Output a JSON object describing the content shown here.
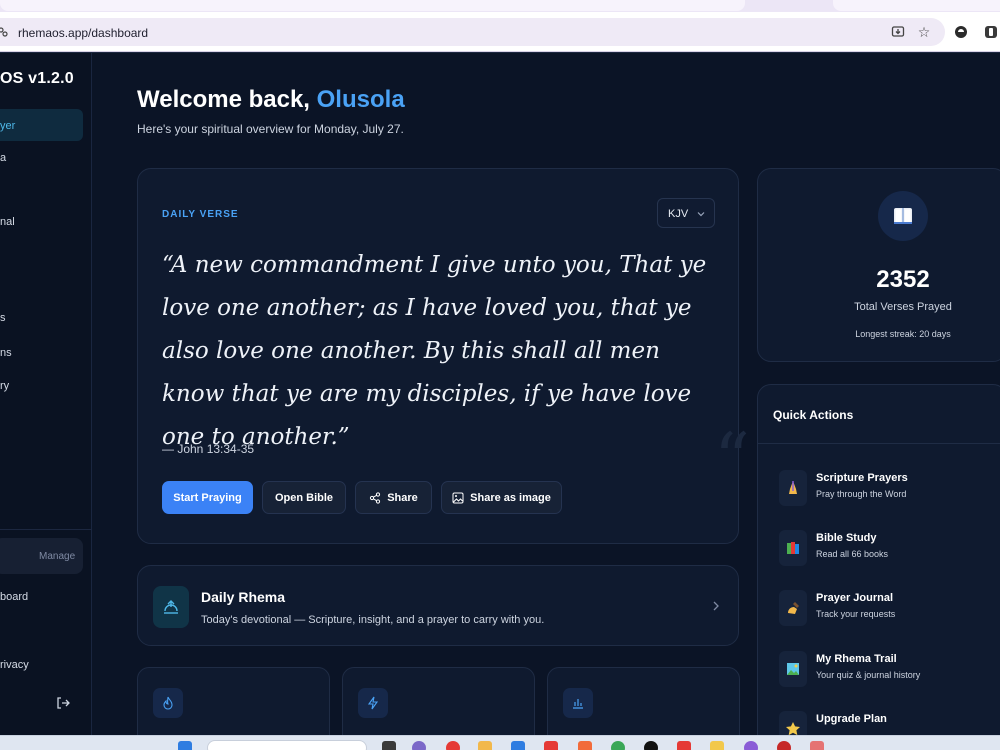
{
  "browser": {
    "url": "rhemaos.app/dashboard",
    "icons": [
      "tune-icon",
      "install-icon",
      "star-icon",
      "extension-icon",
      "extension-icon-2"
    ]
  },
  "sidebar": {
    "brand": "OS v1.2.0",
    "items": [
      {
        "label": "yer",
        "active": true
      },
      {
        "label": "a",
        "active": false
      },
      {
        "label": "nal",
        "active": false
      },
      {
        "label": "s",
        "active": false
      },
      {
        "label": "ns",
        "active": false
      },
      {
        "label": "ry",
        "active": false
      }
    ],
    "manage_label": "Manage",
    "footer_items": [
      {
        "label": "board"
      },
      {
        "label": "rivacy"
      }
    ]
  },
  "header": {
    "welcome_prefix": "Welcome back, ",
    "user_name": "Olusola",
    "overview": "Here's your spiritual overview for Monday, July 27."
  },
  "verse": {
    "label": "DAILY VERSE",
    "translation": "KJV",
    "text": "“A new commandment I give unto you, That ye love one another; as I have loved you, that ye also love one another. By this shall all men know that ye are my disciples, if ye have love one to another.”",
    "reference": "— John 13:34-35",
    "actions": {
      "start_praying": "Start Praying",
      "open_bible": "Open Bible",
      "share": "Share",
      "share_image": "Share as image"
    }
  },
  "daily_rhema": {
    "title": "Daily Rhema",
    "subtitle": "Today's devotional — Scripture, insight, and a prayer to carry with you."
  },
  "stats": {
    "total": "2352",
    "label": "Total Verses Prayed",
    "streak": "Longest streak: 20 days"
  },
  "quick_actions": {
    "title": "Quick Actions",
    "items": [
      {
        "name": "Scripture Prayers",
        "desc": "Pray through the Word",
        "icon": "praying-hands-icon"
      },
      {
        "name": "Bible Study",
        "desc": "Read all 66 books",
        "icon": "books-icon"
      },
      {
        "name": "Prayer Journal",
        "desc": "Track your requests",
        "icon": "writing-hand-icon"
      },
      {
        "name": "My Rhema Trail",
        "desc": "Your quiz & journal history",
        "icon": "picture-icon"
      },
      {
        "name": "Upgrade Plan",
        "desc": "",
        "icon": "star-icon"
      }
    ]
  },
  "colors": {
    "accent": "#4aa2f5",
    "primary_button": "#3b82f6",
    "background": "#0b1426",
    "card": "#0f1a2f"
  }
}
